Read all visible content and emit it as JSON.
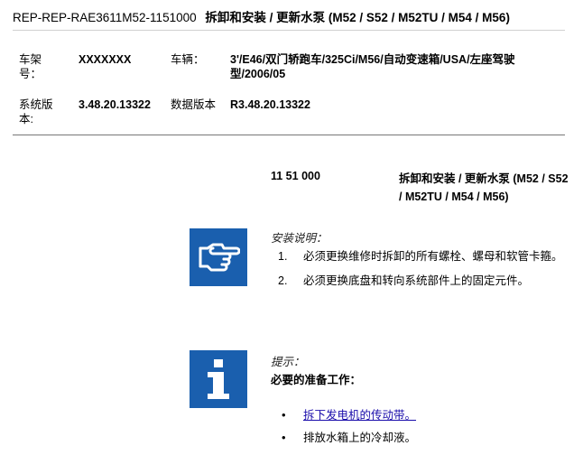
{
  "header": {
    "doc_id": "REP-REP-RAE3611M52-1151000",
    "title": "拆卸和安装 / 更新水泵 (M52 / S52 / M52TU / M54 / M56)"
  },
  "meta": {
    "chassis_label": "车架号：",
    "chassis_value": "XXXXXXX",
    "vehicle_label": "车辆：",
    "vehicle_value": "3'/E46/双门轿跑车/325Ci/M56/自动变速箱/USA/左座驾驶型/2006/05",
    "system_version_label": "系统版本:",
    "system_version_value": "3.48.20.13322",
    "data_version_label": "数据版本",
    "data_version_value": "R3.48.20.13322"
  },
  "step": {
    "number": "11 51 000",
    "title": "拆卸和安装 / 更新水泵 (M52 / S52 / M52TU / M54 / M56)"
  },
  "install_notes": {
    "icon": "pointing-hand-icon",
    "heading": "安装说明：",
    "items": [
      {
        "num": "1.",
        "text": "必须更换维修时拆卸的所有螺栓、螺母和软管卡箍。"
      },
      {
        "num": "2.",
        "text": "必须更换底盘和转向系统部件上的固定元件。"
      }
    ]
  },
  "hint": {
    "icon": "info-icon",
    "heading": "提示：",
    "subheading": "必要的准备工作：",
    "items": [
      {
        "bullet": "•",
        "text": "拆下发电机的传动带。",
        "is_link": true
      },
      {
        "bullet": "•",
        "text": "排放水箱上的冷却液。",
        "is_link": false
      }
    ]
  },
  "colors": {
    "icon_background": "#1a5fae",
    "link": "#1a0dab"
  }
}
